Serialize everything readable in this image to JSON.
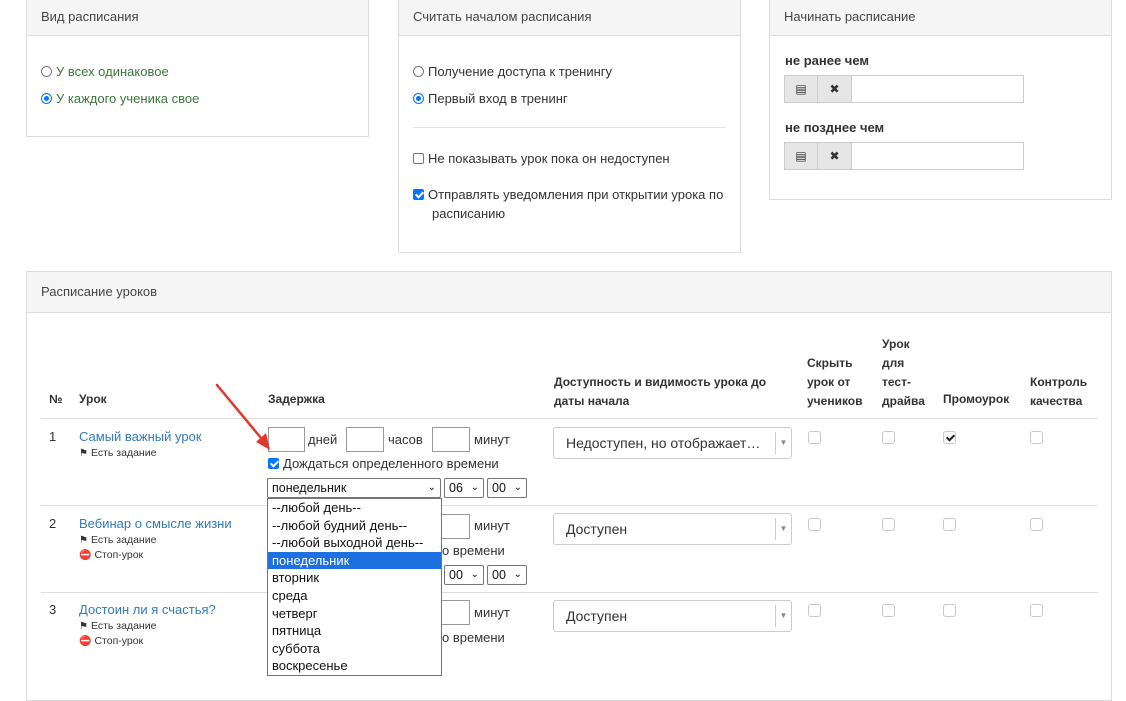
{
  "schedule_view": {
    "title": "Вид расписания",
    "options": [
      "У всех одинаковое",
      "У каждого ученика свое"
    ]
  },
  "schedule_start": {
    "title": "Считать началом расписания",
    "options": [
      "Получение доступа к тренингу",
      "Первый вход в тренинг"
    ],
    "hide_unavailable": "Не показывать урок пока он недоступен",
    "send_notifications_1": "Отправлять уведомления при открытии урока по",
    "send_notifications_2": "расписанию"
  },
  "start_schedule": {
    "title": "Начинать расписание",
    "not_earlier": "не ранее чем",
    "not_later": "не позднее чем",
    "calendar_icon": "calendar-icon",
    "clear_icon": "close-icon"
  },
  "lessons": {
    "title": "Расписание уроков",
    "headers": {
      "num": "№",
      "lesson": "Урок",
      "delay": "Задержка",
      "availability_1": "Доступность и видимость урока до",
      "availability_2": "даты начала",
      "hide_1": "Скрыть",
      "hide_2": "урок от",
      "hide_3": "учеников",
      "test_1": "Урок",
      "test_2": "для",
      "test_3": "тест-",
      "test_4": "драйва",
      "promo": "Промоурок",
      "qc_1": "Контроль",
      "qc_2": "качества"
    },
    "rows": [
      {
        "num": "1",
        "title": "Самый важный урок",
        "tags": [
          "Есть задание"
        ],
        "availability": "Недоступен, но отображает…",
        "days_label": "дней",
        "hours_label": "часов",
        "minutes_label": "минут",
        "wait_label": "Дождаться определенного времени",
        "day_value": "понедельник",
        "hour_value": "06",
        "minute_value": "00"
      },
      {
        "num": "2",
        "title": "Вебинар о смысле жизни",
        "tags": [
          "Есть задание",
          "Стоп-урок"
        ],
        "availability": "Доступен",
        "minutes_label": "минут",
        "wait_tail": "о времени",
        "hour_value": "00",
        "minute_value": "00"
      },
      {
        "num": "3",
        "title": "Достоин ли я счастья?",
        "tags": [
          "Есть задание",
          "Стоп-урок"
        ],
        "availability": "Доступен",
        "minutes_label": "минут",
        "wait_tail": "о времени"
      }
    ]
  },
  "day_dropdown": {
    "options": [
      "--любой день--",
      "--любой будний день--",
      "--любой выходной день--",
      "понедельник",
      "вторник",
      "среда",
      "четверг",
      "пятница",
      "суббота",
      "воскресенье"
    ],
    "highlighted": "понедельник"
  },
  "colors": {
    "accent": "#0075ff",
    "link": "#337ab7",
    "green_text": "#3c763d",
    "arrow": "#e0392b"
  }
}
